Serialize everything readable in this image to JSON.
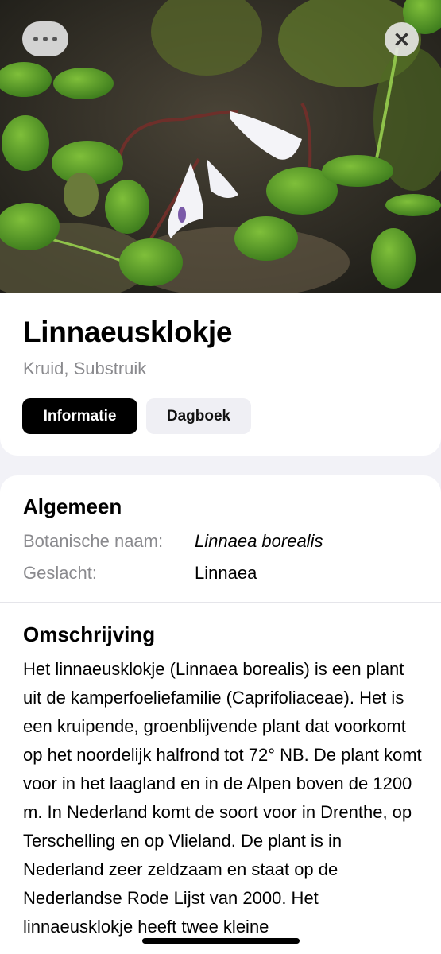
{
  "header": {
    "title": "Linnaeusklokje",
    "subtitle": "Kruid, Substruik"
  },
  "tabs": [
    {
      "label": "Informatie",
      "selected": true
    },
    {
      "label": "Dagboek",
      "selected": false
    }
  ],
  "general": {
    "title": "Algemeen",
    "rows": [
      {
        "label": "Botanische naam:",
        "value": "Linnaea borealis"
      },
      {
        "label": "Geslacht:",
        "value": "Linnaea"
      }
    ]
  },
  "description": {
    "title": "Omschrijving",
    "text": "Het linnaeusklokje (Linnaea borealis) is een plant uit de kamperfoeliefamilie (Caprifoliaceae). Het is een kruipende, groenblijvende plant dat voorkomt op het noordelijk halfrond tot 72° NB. De plant komt voor in het laagland en in de Alpen boven de 1200 m. In Nederland komt de soort voor in Drenthe, op Terschelling en op Vlieland. De plant is in Nederland zeer zeldzaam en staat op de Nederlandse Rode Lijst van 2000. Het linnaeusklokje heeft twee kleine"
  },
  "icons": {
    "more": "ellipsis-icon",
    "close": "close-icon"
  },
  "colors": {
    "selected_tab_bg": "#000000",
    "unselected_tab_bg": "#efeff4",
    "secondary_text": "#8a8a8e",
    "page_bg": "#f2f2f7"
  }
}
